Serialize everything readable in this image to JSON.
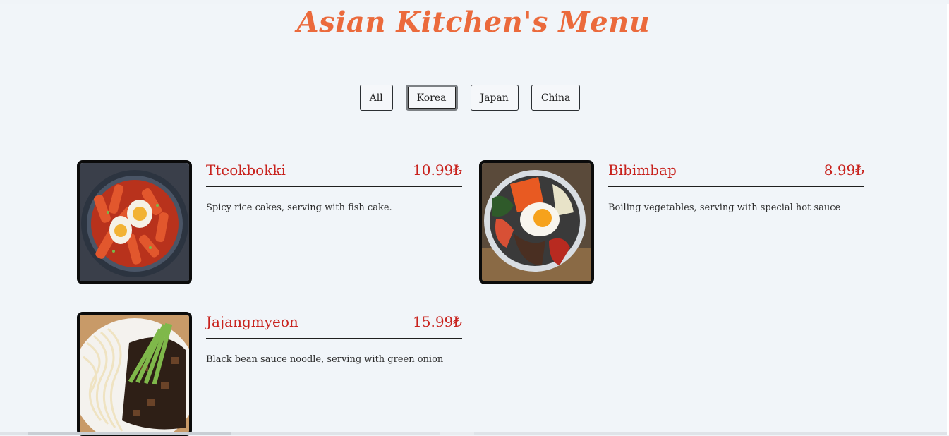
{
  "header": {
    "title": "Asian Kitchen's Menu"
  },
  "filters": [
    {
      "label": "All",
      "active": false
    },
    {
      "label": "Korea",
      "active": true
    },
    {
      "label": "Japan",
      "active": false
    },
    {
      "label": "China",
      "active": false
    }
  ],
  "menu": {
    "items": [
      {
        "name": "Tteokbokki",
        "price": "10.99₺",
        "description": "Spicy rice cakes, serving with fish cake.",
        "image": "tteokbokki-photo"
      },
      {
        "name": "Bibimbap",
        "price": "8.99₺",
        "description": "Boiling vegetables, serving with special hot sauce",
        "image": "bibimbap-photo"
      },
      {
        "name": "Jajangmyeon",
        "price": "15.99₺",
        "description": "Black bean sauce noodle, serving with green onion",
        "image": "jajangmyeon-photo"
      }
    ]
  },
  "colors": {
    "title": "#eb6a3c",
    "accent": "#c8221d",
    "background": "#f1f5f9"
  }
}
